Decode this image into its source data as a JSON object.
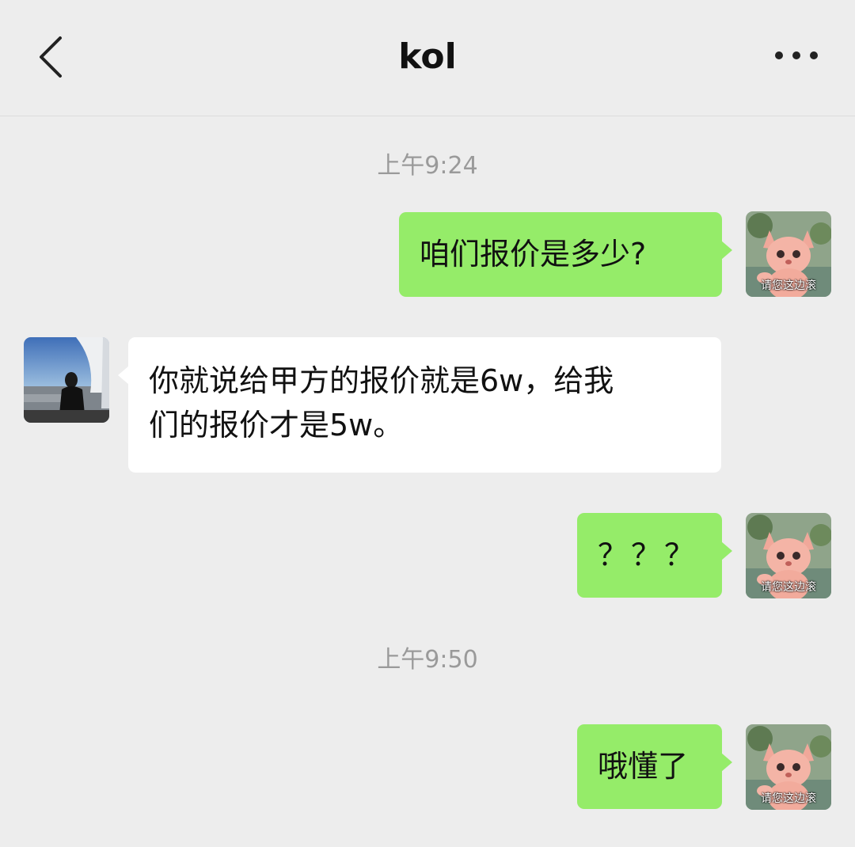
{
  "header": {
    "title": "kol",
    "back_icon": "chevron-left-icon",
    "more_icon": "more-dots-icon"
  },
  "avatars": {
    "me_caption": "请您这边滚"
  },
  "messages": {
    "time1": "上午9:24",
    "m1": "咱们报价是多少?",
    "m2_line1": "你就说给甲方的报价就是6w，给我",
    "m2_line2": "们的报价才是5w。",
    "m3": "？？？",
    "time2": "上午9:50",
    "m4": "哦懂了"
  },
  "colors": {
    "background": "#ededed",
    "my_bubble": "#95ec69",
    "other_bubble": "#ffffff",
    "timestamp": "#9a9a9a"
  }
}
